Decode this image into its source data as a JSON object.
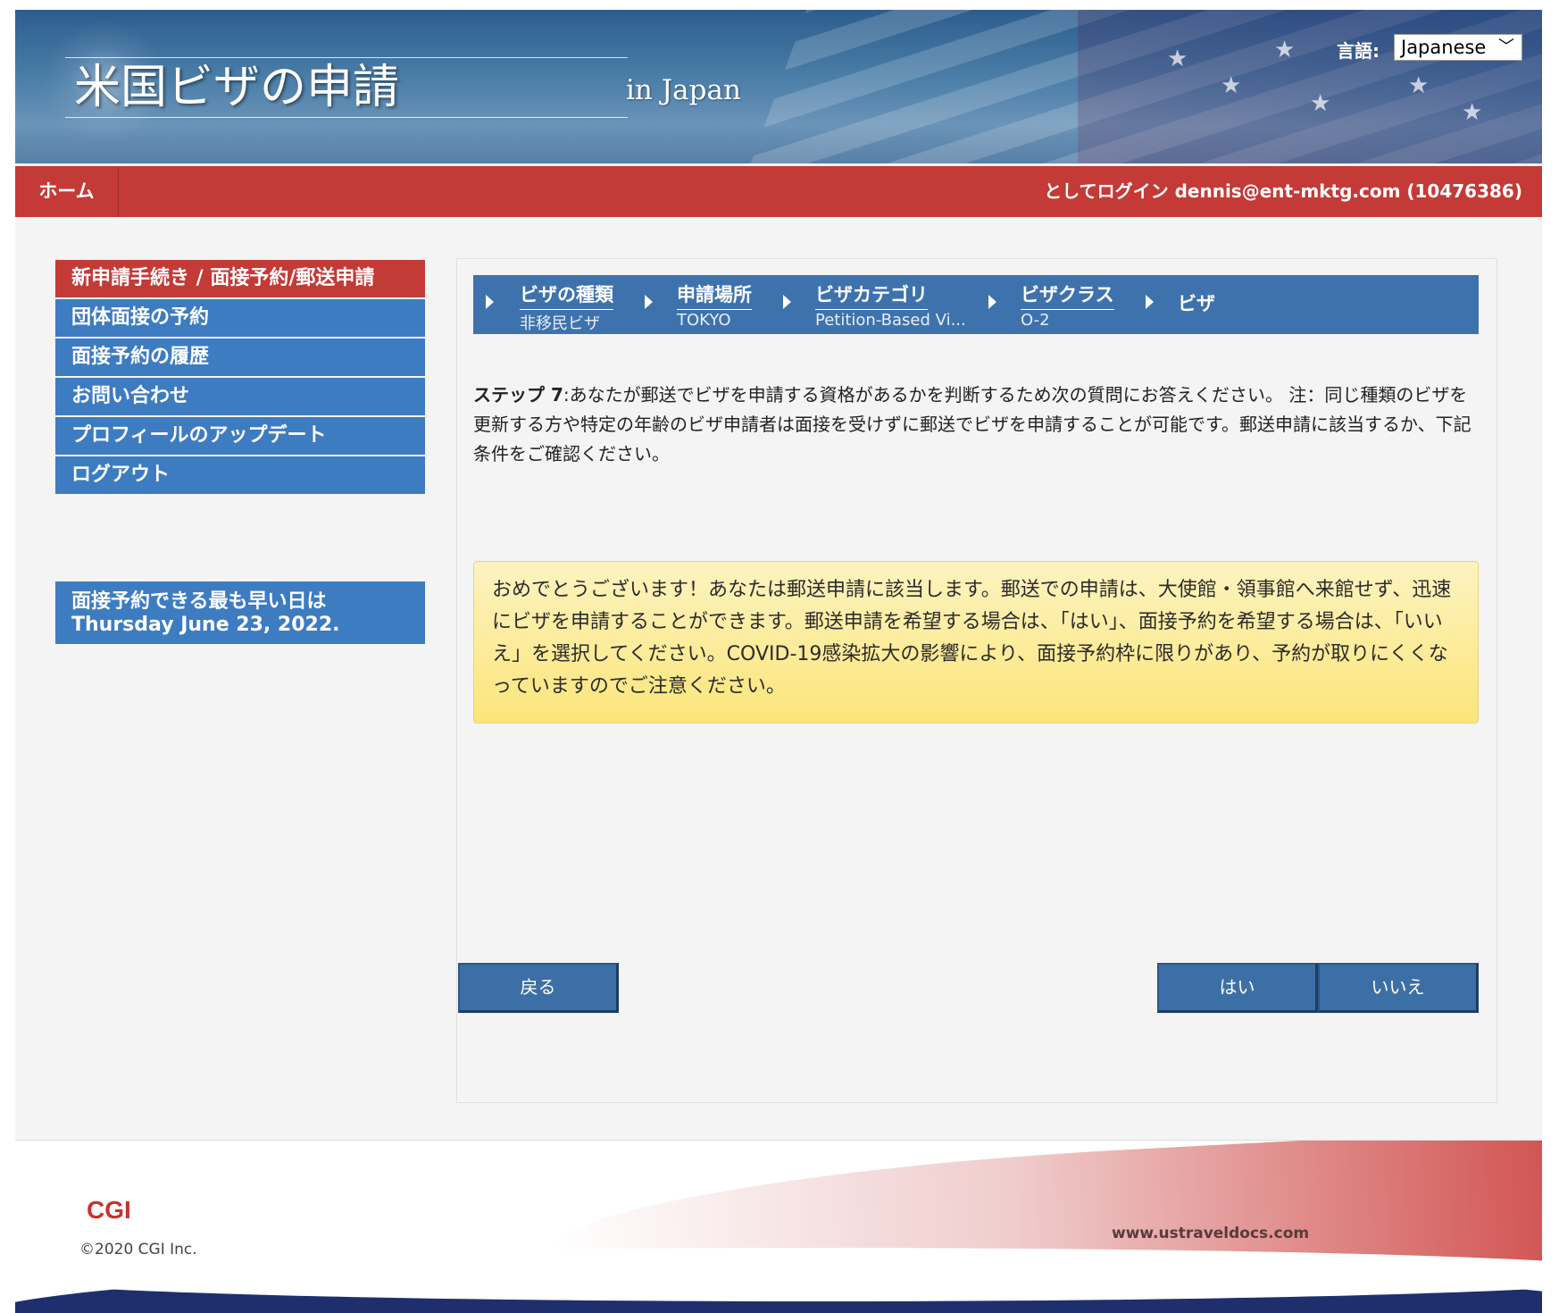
{
  "header": {
    "site_title": "米国ビザの申請",
    "site_subtitle": "in Japan",
    "language_label": "言語:",
    "language_selected": "Japanese"
  },
  "nav": {
    "home": "ホーム",
    "login_status": "としてログイン  dennis@ent-mktg.com (10476386)"
  },
  "sidebar": {
    "items": [
      {
        "label": "新申請手続き / 面接予約/郵送申請",
        "active": true
      },
      {
        "label": "団体面接の予約"
      },
      {
        "label": "面接予約の履歴"
      },
      {
        "label": "お問い合わせ"
      },
      {
        "label": "プロフィールのアップデート"
      },
      {
        "label": "ログアウト"
      }
    ],
    "earliest_label": "面接予約できる最も早い日は",
    "earliest_date": "Thursday June 23, 2022."
  },
  "steps": [
    {
      "label": "ビザの種類",
      "value": "非移民ビザ"
    },
    {
      "label": "申請場所",
      "value": "TOKYO"
    },
    {
      "label": "ビザカテゴリ",
      "value": "Petition-Based Vi..."
    },
    {
      "label": "ビザクラス",
      "value": "O-2"
    },
    {
      "label": "ビザ",
      "value": ""
    }
  ],
  "main": {
    "step_prefix": "ステップ 7",
    "instruction": ":あなたが郵送でビザを申請する資格があるかを判断するため次の質問にお答えください。 注：同じ種類のビザを更新する方や特定の年齢のビザ申請者は面接を受けずに郵送でビザを申請することが可能です。郵送申請に該当するか、下記条件をご確認ください。",
    "notice": "おめでとうございます！あなたは郵送申請に該当します。郵送での申請は、大使館・領事館へ来館せず、迅速にビザを申請することができます。郵送申請を希望する場合は、「はい」、面接予約を希望する場合は、「いいえ」を選択してください。COVID-19感染拡大の影響により、面接予約枠に限りがあり、予約が取りにくくなっていますのでご注意ください。",
    "back_button": "戻る",
    "yes_button": "はい",
    "no_button": "いいえ"
  },
  "footer": {
    "logo": "CGI",
    "copyright": "©2020 CGI Inc.",
    "url": "www.ustraveldocs.com"
  },
  "colors": {
    "nav_red": "#c43a37",
    "menu_blue": "#3d7cc0",
    "steps_blue": "#3d72ad",
    "notice_yellow": "#fbe57a"
  }
}
